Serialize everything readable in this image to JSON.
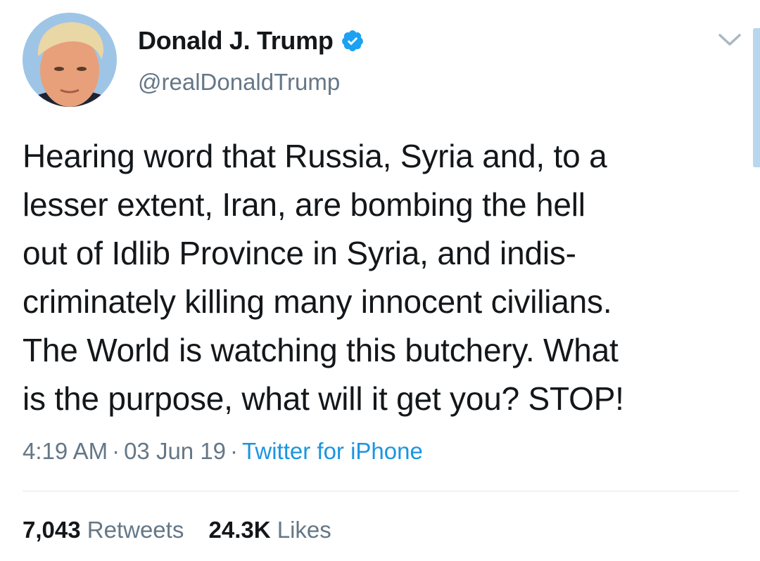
{
  "author": {
    "display_name": "Donald J. Trump",
    "handle": "@realDonaldTrump",
    "verified_icon": "verified-badge-icon",
    "avatar": "profile-photo"
  },
  "tweet": {
    "lines": [
      "Hearing word that Russia, Syria and, to a",
      "lesser extent, Iran, are bombing the hell",
      "out of Idlib Province in Syria, and indis-",
      "criminately killing many innocent civilians.",
      "The World is watching this butchery. What",
      "is the purpose, what will it get you? STOP!"
    ]
  },
  "meta": {
    "time": "4:19 AM",
    "separator": "·",
    "date": "03 Jun 19",
    "source": "Twitter for iPhone"
  },
  "stats": {
    "retweets_count": "7,043",
    "retweets_label": "Retweets",
    "likes_count": "24.3K",
    "likes_label": "Likes"
  },
  "colors": {
    "text": "#14171a",
    "secondary": "#657786",
    "link": "#1b95e0",
    "verified": "#1da1f2",
    "divider": "#e1e8ed"
  }
}
